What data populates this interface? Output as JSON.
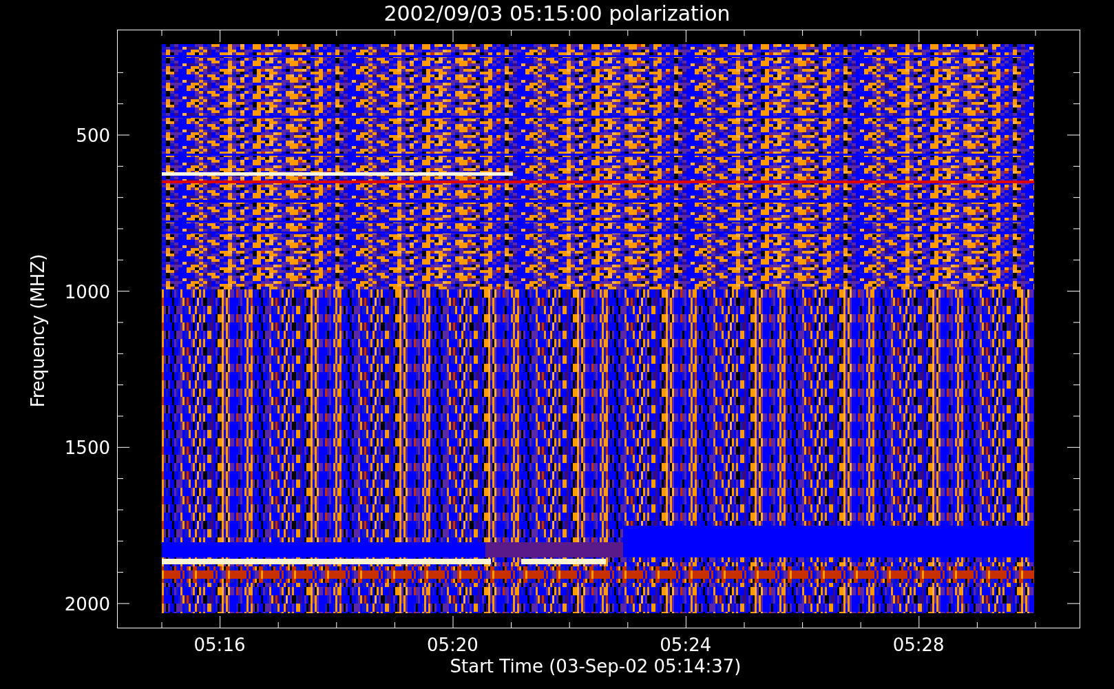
{
  "title": "2002/09/03 05:15:00 polarization",
  "y_axis": {
    "label": "Frequency (MHZ)",
    "ticks": [
      "500",
      "1000",
      "1500",
      "2000"
    ]
  },
  "x_axis": {
    "label": "Start Time (03-Sep-02 05:14:37)",
    "ticks": [
      "05:16",
      "05:20",
      "05:24",
      "05:28"
    ]
  }
}
